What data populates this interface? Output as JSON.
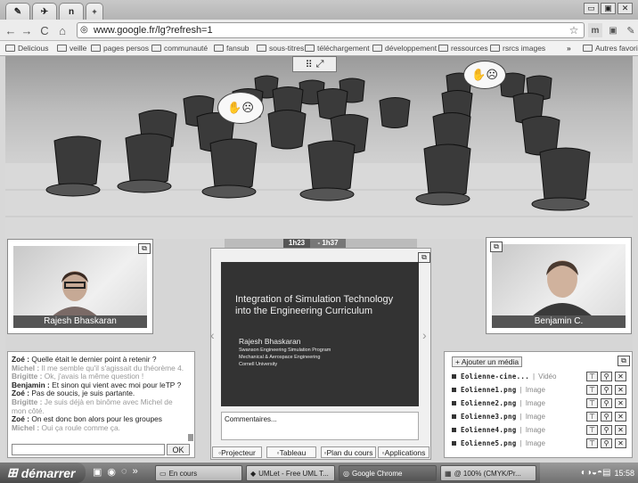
{
  "browser": {
    "tabs": [
      "",
      "",
      "n",
      ""
    ],
    "window_buttons": [
      "▭",
      "▣",
      "✕"
    ],
    "url": "www.google.fr/lg?refresh=1",
    "bookmarks": [
      "Delicious",
      "veille",
      "pages persos",
      "communauté",
      "fansub",
      "sous-titres",
      "téléchargement",
      "développement",
      "ressources",
      "rsrcs images",
      "Autres favoris"
    ],
    "bookmark_more": "»"
  },
  "scene": {
    "time_current": "1h23",
    "time_end": "- 1h37"
  },
  "videos": {
    "left_name": "Rajesh Bhaskaran",
    "right_name": "Benjamin C."
  },
  "slide": {
    "title": "Integration of Simulation Technology into the Engineering Curriculum",
    "author": "Rajesh Bhaskaran",
    "line1": "Swanson Engineering Simulation Program",
    "line2": "Mechanical & Aerospace Engineering",
    "line3": "Cornell University",
    "comments_placeholder": "Commentaires..."
  },
  "bottom_tabs": [
    "Projecteur",
    "Tableau",
    "Plan du cours",
    "Applications"
  ],
  "chat": {
    "lines": [
      {
        "name": "Zoé :",
        "text": " Quelle était le dernier point à retenir ?",
        "alt": false
      },
      {
        "name": "Michel :",
        "text": " Il me semble qu'il s'agissait du théorème 4.",
        "alt": true
      },
      {
        "name": "Brigitte :",
        "text": " Ok, j'avais la même question !",
        "alt": true
      },
      {
        "name": "Benjamin :",
        "text": " Et sinon qui vient avec moi pour leTP ?",
        "alt": false
      },
      {
        "name": "Zoé :",
        "text": " Pas de soucis, je suis partante.",
        "alt": false
      },
      {
        "name": "Brigitte :",
        "text": " Je suis déjà en binôme avec Michel de mon côté.",
        "alt": true
      },
      {
        "name": "Zoé :",
        "text": " On est donc bon alors pour les groupes",
        "alt": false
      },
      {
        "name": "Michel :",
        "text": " Oui ça roule comme ça.",
        "alt": true
      }
    ],
    "ok_label": "OK"
  },
  "media": {
    "add_label": "+ Ajouter un média",
    "items": [
      {
        "name": "Eolienne-cine...",
        "type": "Vidéo"
      },
      {
        "name": "Eolienne1.png",
        "type": "Image"
      },
      {
        "name": "Eolienne2.png",
        "type": "Image"
      },
      {
        "name": "Eolienne3.png",
        "type": "Image"
      },
      {
        "name": "Eolienne4.png",
        "type": "Image"
      },
      {
        "name": "Eolienne5.png",
        "type": "Image"
      }
    ]
  },
  "taskbar": {
    "start": "démarrer",
    "tasks": [
      "En cours",
      "UMLet - Free UML T...",
      "Google Chrome",
      "@ 100% (CMYK/Pr..."
    ],
    "clock": "15:58"
  }
}
